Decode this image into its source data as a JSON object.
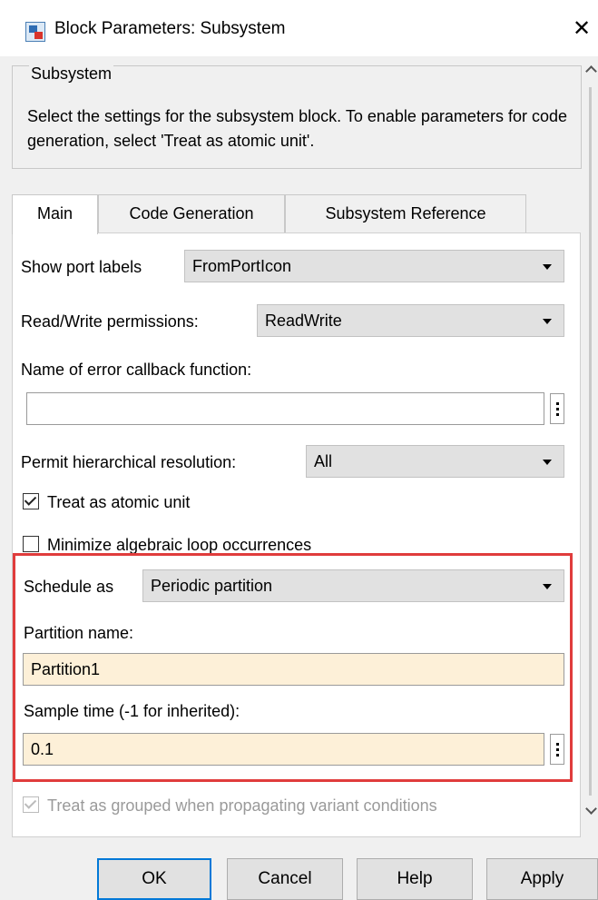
{
  "window": {
    "title": "Block Parameters: Subsystem",
    "close_glyph": "✕"
  },
  "group": {
    "title": "Subsystem",
    "description": "Select the settings for the subsystem block. To enable parameters for code generation, select 'Treat as atomic unit'."
  },
  "tabs": [
    {
      "label": "Main",
      "active": true
    },
    {
      "label": "Code Generation",
      "active": false
    },
    {
      "label": "Subsystem Reference",
      "active": false
    }
  ],
  "main": {
    "show_port_labels": {
      "label": "Show port labels",
      "value": "FromPortIcon"
    },
    "rw_permissions": {
      "label": "Read/Write permissions:",
      "value": "ReadWrite"
    },
    "error_callback": {
      "label": "Name of error callback function:",
      "value": ""
    },
    "hierarchical_resolution": {
      "label": "Permit hierarchical resolution:",
      "value": "All"
    },
    "treat_atomic": {
      "label": "Treat as atomic unit",
      "checked": true
    },
    "minimize_loops": {
      "label": "Minimize algebraic loop occurrences",
      "checked": false
    },
    "schedule_as": {
      "label": "Schedule as",
      "value": "Periodic partition"
    },
    "partition_name": {
      "label": "Partition name:",
      "value": "Partition1"
    },
    "sample_time": {
      "label": "Sample time (-1 for inherited):",
      "value": "0.1"
    },
    "treat_grouped": {
      "label": "Treat as grouped when propagating variant conditions",
      "checked": true,
      "disabled": true
    }
  },
  "buttons": {
    "ok": "OK",
    "cancel": "Cancel",
    "help": "Help",
    "apply": "Apply"
  },
  "colors": {
    "highlight_border": "#e03c3c",
    "field_highlight": "#fdf0d8",
    "default_button_border": "#0078d7"
  }
}
